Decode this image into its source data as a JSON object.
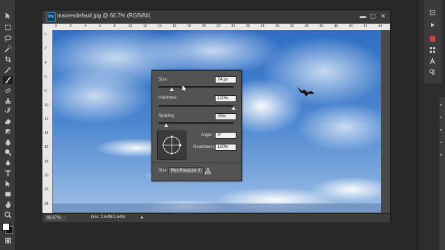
{
  "document": {
    "title": "maxresdefault.jpg @ 66.7% (RGB/8#)",
    "ps_badge": "Ps",
    "status_zoom": "66.67%",
    "status_doc": "Doc: 2.64M/2.64M"
  },
  "rulers": {
    "h_ticks": [
      "0",
      "2",
      "4",
      "6",
      "8",
      "10",
      "12",
      "14",
      "16",
      "18",
      "20",
      "22",
      "24",
      "26",
      "28",
      "30",
      "32",
      "34",
      "36",
      "38",
      "40",
      "42",
      "44"
    ],
    "v_ticks": [
      "0",
      "2",
      "4",
      "6",
      "8",
      "10",
      "12",
      "14",
      "16",
      "18",
      "20",
      "22",
      "24"
    ]
  },
  "brush_popup": {
    "size_label": "Size:",
    "size_value": "74 px",
    "size_fraction": 0.18,
    "hardness_label": "Hardness:",
    "hardness_value": "100%",
    "hardness_fraction": 1.0,
    "spacing_label": "Spacing:",
    "spacing_value": "25%",
    "spacing_fraction": 0.1,
    "angle_label": "Angle:",
    "angle_value": "0°",
    "roundness_label": "Roundness:",
    "roundness_value": "100%",
    "bottom_size_label": "Size:",
    "bottom_size_select": "Pen Pressure",
    "pressure_icon": "pressure-triangle-icon"
  },
  "colors": {
    "foreground": "#ffffff",
    "background": "#111111"
  },
  "tools": [
    "move-tool-icon",
    "marquee-tool-icon",
    "lasso-tool-icon",
    "quick-select-tool-icon",
    "crop-tool-icon",
    "eyedropper-tool-icon",
    "healing-brush-tool-icon",
    "brush-tool-icon",
    "clone-stamp-tool-icon",
    "history-brush-tool-icon",
    "eraser-tool-icon",
    "gradient-tool-icon",
    "blur-tool-icon",
    "dodge-tool-icon",
    "pen-tool-icon",
    "type-tool-icon",
    "path-select-tool-icon",
    "shape-tool-icon",
    "hand-tool-icon",
    "zoom-tool-icon"
  ]
}
